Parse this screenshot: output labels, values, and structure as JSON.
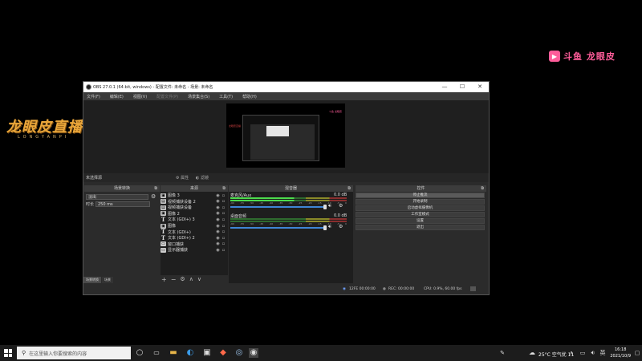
{
  "overlay": {
    "douyu_logo": "斗鱼",
    "douyu_text": "斗鱼 龙眼皮",
    "brand_title": "龙眼皮直播",
    "brand_sub": "LONGYANPI"
  },
  "window": {
    "title": "OBS 27.0.1 (64-bit, windows) - 配置文件: 未命名 - 场景: 未命名",
    "menu": [
      "文件(F)",
      "编辑(E)",
      "视图(V)",
      "配置文件(P)",
      "场景集合(S)",
      "工具(T)",
      "帮助(H)"
    ]
  },
  "scene_bar": {
    "scene_name": "未选择源",
    "properties": "属性",
    "filters": "滤镜"
  },
  "transitions": {
    "title": "场景转换",
    "type": "淡出",
    "duration_label": "时长",
    "duration_value": "250 ms",
    "tab_transitions": "场景转换",
    "tab_scenes": "场景"
  },
  "sources": {
    "title": "来源",
    "items": [
      {
        "icon": "image-icon",
        "label": "图像 3"
      },
      {
        "icon": "video-capture-icon",
        "label": "视频捕获设备 2"
      },
      {
        "icon": "video-capture-icon",
        "label": "视频捕获设备"
      },
      {
        "icon": "image-icon",
        "label": "图像 2"
      },
      {
        "icon": "text-icon",
        "label": "文本 (GDI+) 3"
      },
      {
        "icon": "image-icon",
        "label": "图像"
      },
      {
        "icon": "text-icon",
        "label": "文本 (GDI+)"
      },
      {
        "icon": "text-icon",
        "label": "文本 (GDI+) 2"
      },
      {
        "icon": "window-capture-icon",
        "label": "窗口捕获"
      },
      {
        "icon": "display-capture-icon",
        "label": "显示器捕获"
      }
    ]
  },
  "mixer": {
    "title": "混音器",
    "channels": [
      {
        "name": "麦克风/Aux",
        "db": "0.0 dB",
        "level": 0.55
      },
      {
        "name": "桌面音频",
        "db": "0.0 dB",
        "level": 0
      }
    ],
    "ticks": [
      "-60",
      "-55",
      "-50",
      "-45",
      "-40",
      "-35",
      "-30",
      "-25",
      "-20",
      "-15",
      "-10",
      "-5",
      "0"
    ]
  },
  "controls": {
    "title": "控件",
    "buttons": [
      "停止推流",
      "开始录制",
      "启动虚拟摄像机",
      "工作室模式",
      "设置",
      "退出"
    ]
  },
  "status": {
    "dropped": "12FE  00:00:00",
    "live": "00:00:00",
    "rec": "REC: 00:00:00",
    "cpu": "CPU: 0.9%, 60.00 fps"
  },
  "taskbar": {
    "search_placeholder": "在这里输入你要搜索的内容",
    "weather": "25°C 空气优 11",
    "time": "16:18",
    "date": "2021/10/9"
  }
}
